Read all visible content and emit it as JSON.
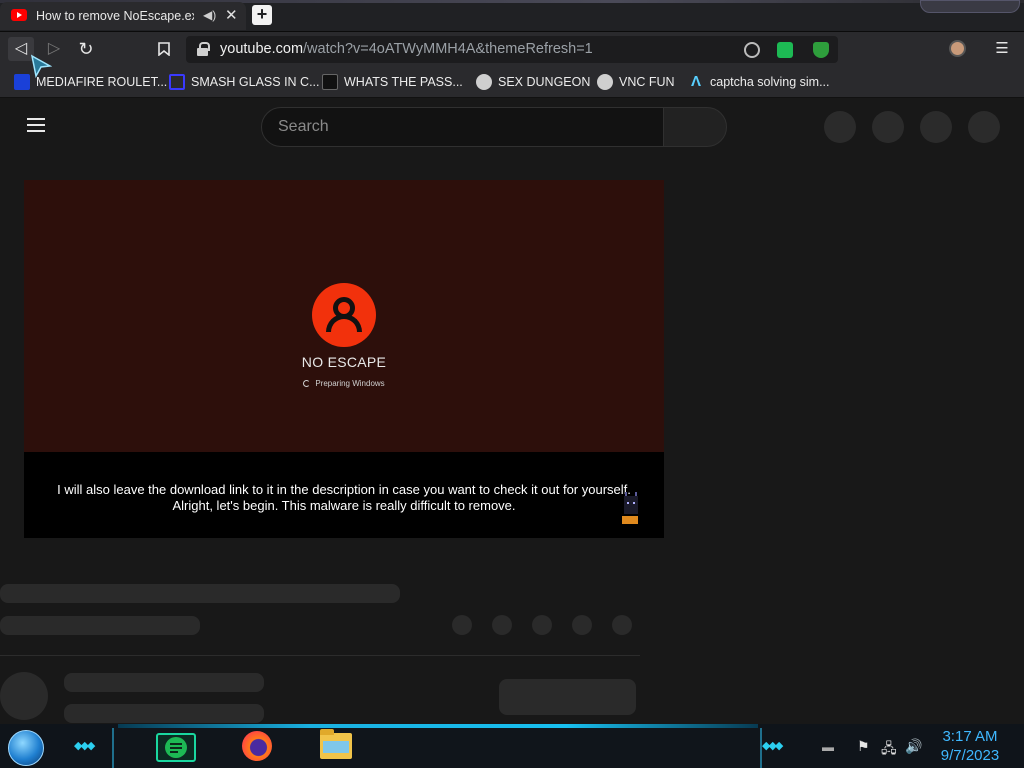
{
  "browser": {
    "tab": {
      "title": "How to remove NoEscape.exe",
      "audio_icon": "speaker-icon",
      "close_glyph": "✕"
    },
    "new_tab_glyph": "+",
    "url_domain": "youtube.com",
    "url_path": "/watch?v=4oATWyMMH4A&themeRefresh=1",
    "nav": {
      "back": "◁",
      "forward": "▷",
      "reload": "↻",
      "bookmark": "☐",
      "menu": "☰"
    },
    "bookmarks": [
      {
        "label": "MEDIAFIRE ROULET...",
        "icon": "mediafire-icon",
        "color": "#1a40d8"
      },
      {
        "label": "SMASH GLASS IN C...",
        "icon": "glass-icon",
        "color": "#3a3aff"
      },
      {
        "label": "WHATS THE PASS...",
        "icon": "password-icon",
        "color": "#111111"
      },
      {
        "label": "SEX DUNGEON",
        "icon": "dungeon-icon",
        "color": "#d0d0d0"
      },
      {
        "label": "VNC FUN",
        "icon": "vnc-icon",
        "color": "#d0d0d0"
      },
      {
        "label": "captcha solving sim...",
        "icon": "captcha-icon",
        "color": "#58d0ff"
      }
    ]
  },
  "youtube": {
    "search_placeholder": "Search",
    "video": {
      "screen_title": "NO ESCAPE",
      "screen_status": "Preparing Windows",
      "caption": "I will also leave the download link to it in the description in case you want to check it out for yourself. Alright, let's begin. This malware is really difficult to remove.",
      "logo_color": "#f2310c"
    }
  },
  "taskbar": {
    "clock_time": "3:17 AM",
    "clock_date": "9/7/2023",
    "tray_icons": [
      "flag-icon",
      "network-icon",
      "volume-icon"
    ]
  }
}
